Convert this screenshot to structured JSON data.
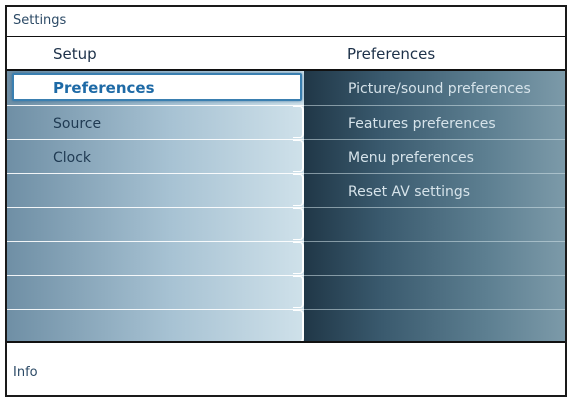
{
  "window": {
    "title": "Settings"
  },
  "left_panel": {
    "header": "Setup",
    "items": [
      "Preferences",
      "Source",
      "Clock"
    ],
    "selected_index": 0
  },
  "right_panel": {
    "header": "Preferences",
    "items": [
      "Picture/sound preferences",
      "Features preferences",
      "Menu preferences",
      "Reset AV settings"
    ]
  },
  "footer": {
    "info_label": "Info"
  },
  "colors": {
    "selection_border": "#3a7fb0",
    "selection_text": "#1e6aa6",
    "header_text": "#1d3149"
  }
}
